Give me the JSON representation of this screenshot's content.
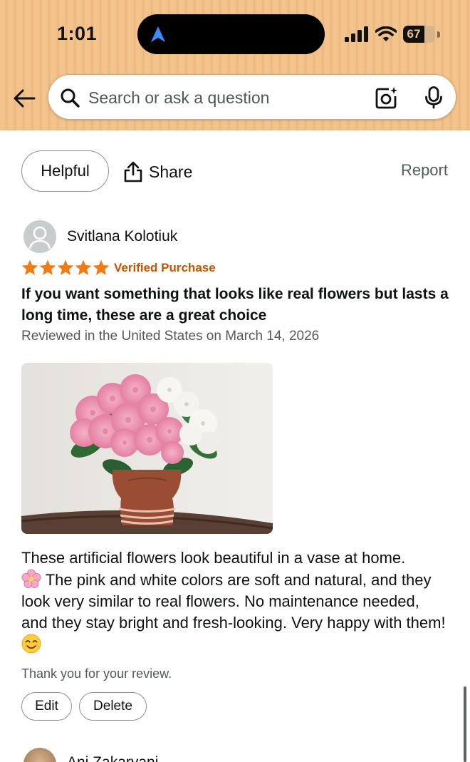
{
  "status_bar": {
    "time": "1:01",
    "battery_percent": "67",
    "battery_level": 0.67,
    "icons": [
      "navigation-arrow-icon",
      "cellular-signal-icon",
      "wifi-icon",
      "battery-icon"
    ]
  },
  "header": {
    "back_icon": "back-arrow-icon",
    "search": {
      "placeholder": "Search or ask a question",
      "value": "",
      "search_icon": "search-icon",
      "camera_icon": "camera-lens-icon",
      "mic_icon": "microphone-icon"
    }
  },
  "review_actions": {
    "helpful_label": "Helpful",
    "share_label": "Share",
    "report_label": "Report"
  },
  "review": {
    "reviewer_name": "Svitlana Kolotiuk",
    "rating": 5,
    "rating_max": 5,
    "verified_label": "Verified Purchase",
    "title": "If you want something that looks like real flowers but lasts a long time, these are a great choice",
    "date_line": "Reviewed in the United States on March 14, 2026",
    "body_part1": "These artificial flowers look beautiful in a vase at home.",
    "body_part2": "The pink and white colors are soft and natural, and they look very similar to real flowers. No maintenance needed, and they stay bright and fresh-looking. Very happy with them!",
    "thanks_note": "Thank you for your review.",
    "edit_label": "Edit",
    "delete_label": "Delete"
  },
  "next_review": {
    "reviewer_name": "Ani Zakaryani..."
  },
  "colors": {
    "header_bg": "#f2c38c",
    "star": "#f27b13",
    "verified": "#c45500",
    "text_primary": "#0f1111",
    "text_secondary": "#565959"
  }
}
